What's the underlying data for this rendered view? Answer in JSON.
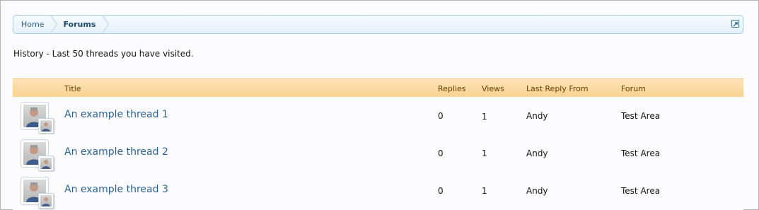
{
  "breadcrumb": {
    "items": [
      {
        "label": "Home"
      },
      {
        "label": "Forums"
      }
    ]
  },
  "intro_text": "History - Last 50 threads you have visited.",
  "table": {
    "headers": {
      "title": "Title",
      "replies": "Replies",
      "views": "Views",
      "last_reply_from": "Last Reply From",
      "forum": "Forum"
    },
    "rows": [
      {
        "title": "An example thread 1",
        "replies": "0",
        "views": "1",
        "last_reply_from": "Andy",
        "forum": "Test Area"
      },
      {
        "title": "An example thread 2",
        "replies": "0",
        "views": "1",
        "last_reply_from": "Andy",
        "forum": "Test Area"
      },
      {
        "title": "An example thread 3",
        "replies": "0",
        "views": "1",
        "last_reply_from": "Andy",
        "forum": "Test Area"
      }
    ]
  },
  "icons": {
    "jump_to": "external-jump-icon",
    "avatar": "user-avatar"
  },
  "colors": {
    "link": "#2a6496",
    "header_bg": "#f8d38e",
    "breadcrumb_border": "#a9cde6"
  }
}
